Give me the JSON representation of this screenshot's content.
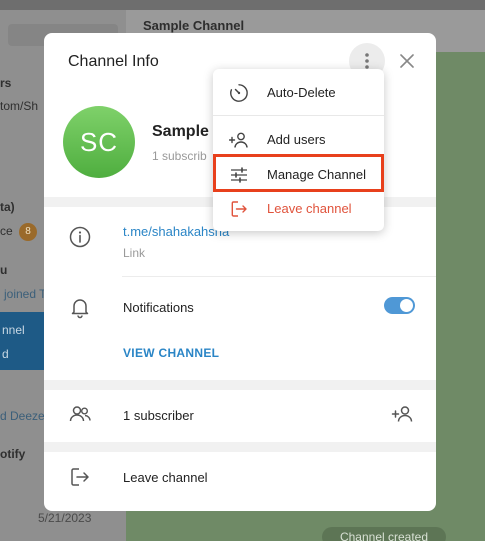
{
  "background": {
    "chat_title": "Sample Channel",
    "sidebar_fragments": [
      "rs",
      "tom/Sh",
      "ta)",
      "ce",
      "u",
      "joined T",
      "nnel",
      "d",
      "d Deeze",
      "otify"
    ],
    "badge": "8",
    "timestamp": "5/21/2023",
    "pill": "Channel created"
  },
  "dialog": {
    "title": "Channel Info",
    "avatar_initials": "SC",
    "channel_name": "Sample",
    "subscribers_short": "1 subscrib",
    "link": "t.me/shahakahsha",
    "link_label": "Link",
    "notifications_label": "Notifications",
    "notifications_on": true,
    "view_channel": "VIEW CHANNEL",
    "subscribers": "1 subscriber",
    "leave": "Leave channel"
  },
  "menu": {
    "items": [
      {
        "label": "Auto-Delete",
        "icon": "timer-icon"
      },
      {
        "label": "Add users",
        "icon": "add-user-icon"
      },
      {
        "label": "Manage Channel",
        "icon": "sliders-icon",
        "highlighted": true
      },
      {
        "label": "Leave channel",
        "icon": "logout-icon",
        "danger": true
      }
    ]
  },
  "colors": {
    "accent": "#2a85c6",
    "toggle_on": "#4f98d6",
    "danger": "#e0533c",
    "highlight_box": "#e8401c",
    "avatar": "#5cbd4a"
  }
}
